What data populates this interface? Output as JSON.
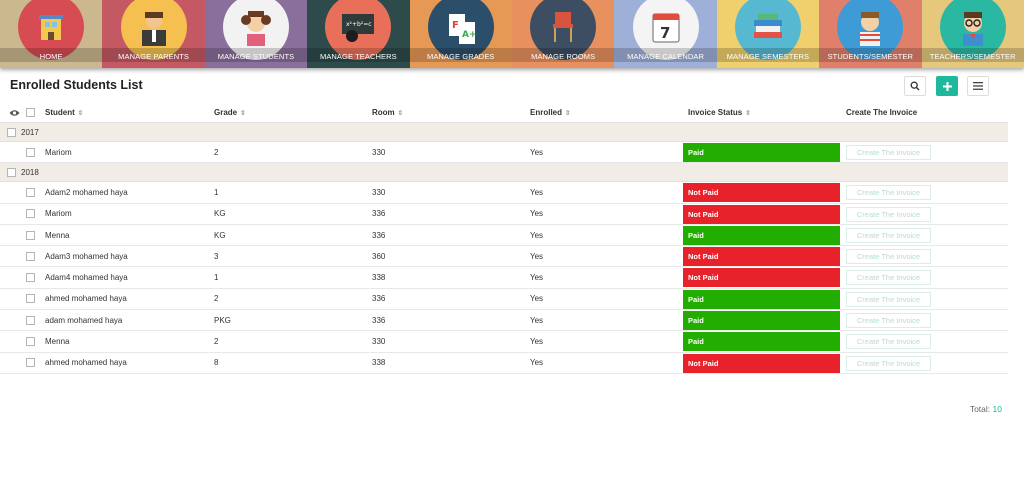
{
  "nav": [
    {
      "label": "HOME",
      "bg": "#ccb88f",
      "circle": "#d74b53"
    },
    {
      "label": "MANAGE PARENTS",
      "bg": "#c45963",
      "circle": "#f5c04f"
    },
    {
      "label": "MANAGE STUDENTS",
      "bg": "#8a6e9c",
      "circle": "#f2f2f2"
    },
    {
      "label": "MANAGE TEACHERS",
      "bg": "#2e4b4b",
      "circle": "#e8705a"
    },
    {
      "label": "MANAGE GRADES",
      "bg": "#e59955",
      "circle": "#2b4f6b"
    },
    {
      "label": "MANAGE ROOMS",
      "bg": "#e8905e",
      "circle": "#3e4e62"
    },
    {
      "label": "MANAGE CALENDAR",
      "bg": "#9eb0d8",
      "circle": "#f4f4f4"
    },
    {
      "label": "MANAGE SEMESTERS",
      "bg": "#efd06c",
      "circle": "#56b9d1"
    },
    {
      "label": "STUDENTS/SEMESTER",
      "bg": "#e07f6a",
      "circle": "#3e9bd6"
    },
    {
      "label": "TEACHERS/SEMESTER",
      "bg": "#e6c87d",
      "circle": "#2bb8a3"
    }
  ],
  "header": {
    "title": "Enrolled Students List",
    "search_icon": "search-icon",
    "add_icon": "plus-icon",
    "menu_icon": "hamburger-icon"
  },
  "columns": {
    "student": "Student",
    "grade": "Grade",
    "room": "Room",
    "enrolled": "Enrolled",
    "invoice_status": "Invoice Status",
    "create_invoice": "Create The Invoice"
  },
  "groups": [
    {
      "year": "2017",
      "rows": [
        {
          "student": "Mariom",
          "grade": "2",
          "room": "330",
          "enrolled": "Yes",
          "status": "Paid",
          "paid": true,
          "action": "Create The Invoice"
        }
      ]
    },
    {
      "year": "2018",
      "rows": [
        {
          "student": "Adam2 mohamed haya",
          "grade": "1",
          "room": "330",
          "enrolled": "Yes",
          "status": "Not Paid",
          "paid": false,
          "action": "Create The Invoice"
        },
        {
          "student": "Mariom",
          "grade": "KG",
          "room": "336",
          "enrolled": "Yes",
          "status": "Not Paid",
          "paid": false,
          "action": "Create The Invoice"
        },
        {
          "student": "Menna",
          "grade": "KG",
          "room": "336",
          "enrolled": "Yes",
          "status": "Paid",
          "paid": true,
          "action": "Create The Invoice"
        },
        {
          "student": "Adam3 mohamed haya",
          "grade": "3",
          "room": "360",
          "enrolled": "Yes",
          "status": "Not Paid",
          "paid": false,
          "action": "Create The Invoice"
        },
        {
          "student": "Adam4 mohamed haya",
          "grade": "1",
          "room": "338",
          "enrolled": "Yes",
          "status": "Not Paid",
          "paid": false,
          "action": "Create The Invoice"
        },
        {
          "student": "ahmed mohamed haya",
          "grade": "2",
          "room": "336",
          "enrolled": "Yes",
          "status": "Paid",
          "paid": true,
          "action": "Create The Invoice"
        },
        {
          "student": "adam mohamed haya",
          "grade": "PKG",
          "room": "336",
          "enrolled": "Yes",
          "status": "Paid",
          "paid": true,
          "action": "Create The Invoice"
        },
        {
          "student": "Menna",
          "grade": "2",
          "room": "330",
          "enrolled": "Yes",
          "status": "Paid",
          "paid": true,
          "action": "Create The Invoice"
        },
        {
          "student": "ahmed mohamed haya",
          "grade": "8",
          "room": "338",
          "enrolled": "Yes",
          "status": "Not Paid",
          "paid": false,
          "action": "Create The Invoice"
        }
      ]
    }
  ],
  "footer": {
    "total_label": "Total:",
    "total_value": "10"
  }
}
